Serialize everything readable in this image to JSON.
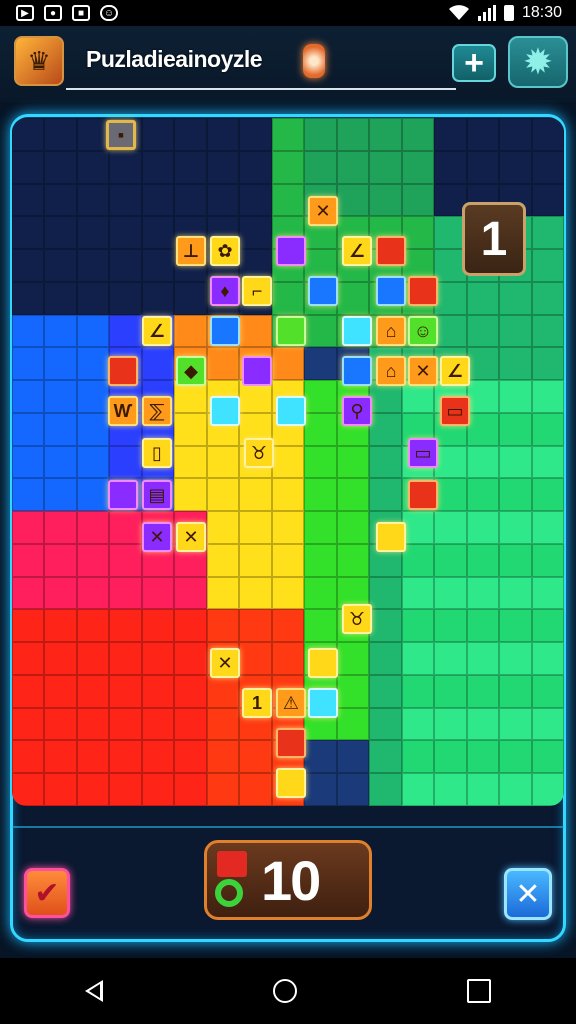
{
  "status_bar": {
    "time": "18:30",
    "icons": [
      "notification-icon",
      "message-icon",
      "gallery-icon",
      "android-icon"
    ]
  },
  "header": {
    "title": "Puzladieainoyzle",
    "add_label": "+",
    "settings_icon": "gear-icon"
  },
  "board": {
    "columns": 17,
    "rows": 21,
    "level": "1"
  },
  "footer": {
    "counter_value": "10",
    "confirm_icon": "checkmark-icon",
    "cancel_icon": "close-icon"
  },
  "colors": {
    "frame": "#33d8ff",
    "background": "#071425"
  }
}
